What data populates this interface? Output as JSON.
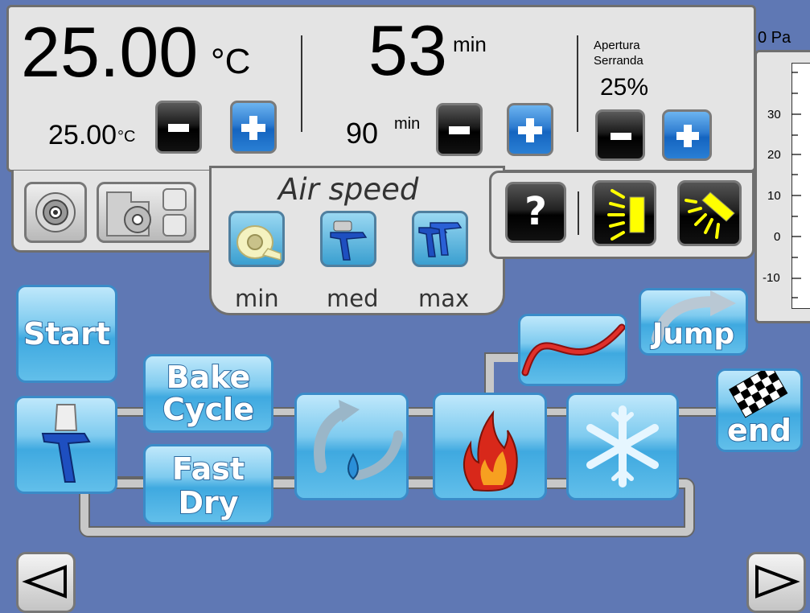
{
  "top": {
    "temperature": {
      "value": "25.00",
      "unit": "°C",
      "setpoint": "25.00",
      "setpoint_unit": "°C"
    },
    "time": {
      "value": "53",
      "unit": "min",
      "setpoint": "90",
      "setpoint_unit": "min"
    },
    "damper": {
      "label_line1": "Apertura",
      "label_line2": "Serranda",
      "value": "25%"
    },
    "pressure": {
      "value": "0 Pa",
      "ticks": [
        "30",
        "20",
        "10",
        "0",
        "-10"
      ]
    }
  },
  "air_speed": {
    "title": "Air speed",
    "options": [
      {
        "label": "min",
        "icon": "tape-roll-icon"
      },
      {
        "label": "med",
        "icon": "spray-gun-icon"
      },
      {
        "label": "max",
        "icon": "double-spray-gun-icon"
      }
    ]
  },
  "cycle": {
    "start_label": "Start",
    "bake_label": [
      "Bake",
      "Cycle"
    ],
    "fast_label": [
      "Fast",
      "Dry"
    ],
    "jump_label": "Jump",
    "end_label": "end"
  },
  "help": {
    "label": "?"
  },
  "colors": {
    "background": "#5f78b4",
    "tile_blue": "#3fa9e0",
    "panel": "#e4e4e4",
    "plus_blue": "#2e7cd0",
    "lamp_yellow": "#ffff00"
  }
}
